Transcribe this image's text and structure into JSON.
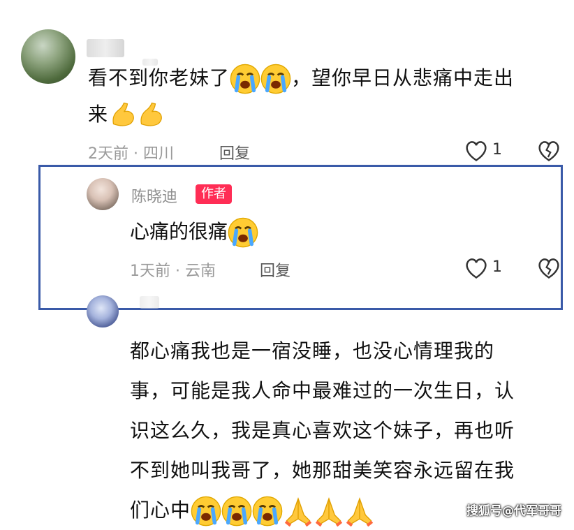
{
  "comment1": {
    "line1": "看不到你老妹了",
    "line1_after": "，望你早日从悲痛中走出",
    "line2": "来",
    "time_location": "2天前 · 四川",
    "reply_label": "回复",
    "likes": "1"
  },
  "reply1": {
    "author": "陈晓迪",
    "badge": "作者",
    "text": "心痛的很痛",
    "time_location": "1天前 · 云南",
    "reply_label": "回复",
    "likes": "1"
  },
  "comment2": {
    "lines": [
      "都心痛我也是一宿没睡，也没心情理我的",
      "事，可能是我人命中最难过的一次生日，认",
      "识这么久，我是真心喜欢这个妹子，再也听",
      "不到她叫我哥了，她那甜美笑容永远留在我",
      "们心中"
    ]
  },
  "watermark": "搜狐号@代军哥哥",
  "colors": {
    "highlight_border": "#3a5aa8",
    "author_badge": "#ff2d55"
  },
  "icons": [
    "heart-outline-icon",
    "broken-heart-icon",
    "crying-face-icon",
    "flexed-biceps-icon",
    "folded-hands-icon"
  ]
}
